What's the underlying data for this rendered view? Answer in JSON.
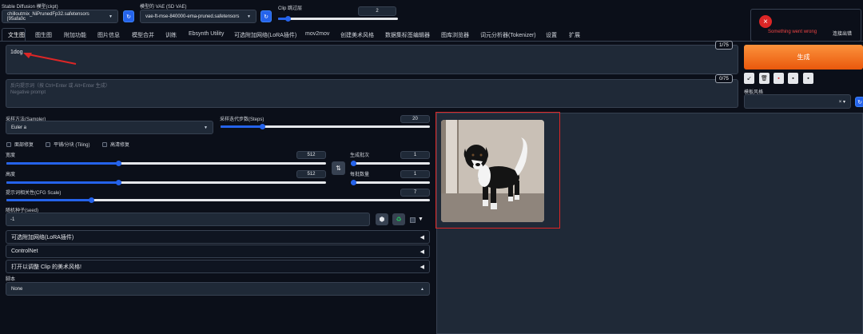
{
  "header": {
    "ckpt_label": "Stable Diffusion 模型(ckpt)",
    "ckpt_value": "chilloutmix_NiPrunedFp32.safetensors [95afa0c",
    "vae_label": "模型的 VAE (SD VAE)",
    "vae_value": "vae-ft-mse-840000-ema-pruned.safetensors",
    "clip_label": "Clip 跳过层",
    "clip_value": "2",
    "clip_level": 0.08
  },
  "error": {
    "message": "Something went wrong",
    "close": "连接出错"
  },
  "tabs": [
    "文生图",
    "图生图",
    "附加功能",
    "图片信息",
    "模型合并",
    "训练",
    "Ebsynth Utility",
    "可选附加网络(LoRA插件)",
    "mov2mov",
    "创建美术风格",
    "数据集标签编辑器",
    "图库浏览器",
    "词元分析器(Tokenizer)",
    "设置",
    "扩展"
  ],
  "prompt": {
    "value": "1dog",
    "counter": "1/75",
    "neg_placeholder": "反向提示词（按 Ctrl+Enter 或 Alt+Enter 生成）\nNegative prompt",
    "neg_counter": "0/75"
  },
  "generate": {
    "label": "生成"
  },
  "style": {
    "label": "模板风格",
    "clear": "×",
    "caret": "▾"
  },
  "tools": [
    "↙",
    "🗑",
    "▪",
    "▪",
    "▪"
  ],
  "sampler": {
    "label": "采样方法(Sampler)",
    "value": "Euler a",
    "steps_label": "采样迭代步数(Steps)",
    "steps": "20",
    "steps_level": 0.2
  },
  "checks": [
    "面部修复",
    "平铺/分块 (Tiling)",
    "高清修复"
  ],
  "size": {
    "width_label": "宽度",
    "width": "512",
    "width_level": 0.35,
    "height_label": "高度",
    "height": "512",
    "height_level": 0.35,
    "swap": "⇅",
    "batch_count_label": "生成批次",
    "batch_count": "1",
    "batch_count_level": 0.0,
    "batch_size_label": "每批数量",
    "batch_size": "1",
    "batch_size_level": 0.0
  },
  "cfg": {
    "label": "提示词相关性(CFG Scale)",
    "value": "7",
    "level": 0.2
  },
  "seed": {
    "label": "随机种子(seed)",
    "value": "-1",
    "dice": "⬢",
    "recycle": "♻"
  },
  "accordions": [
    "可选附加网络(LoRA插件)",
    "ControlNet",
    "打开以调整 Clip 的美术风格!"
  ],
  "script": {
    "label": "脚本",
    "value": "None"
  },
  "colors": {
    "accent": "#2563eb",
    "generate": "#f97316",
    "highlight": "#dc2626"
  }
}
